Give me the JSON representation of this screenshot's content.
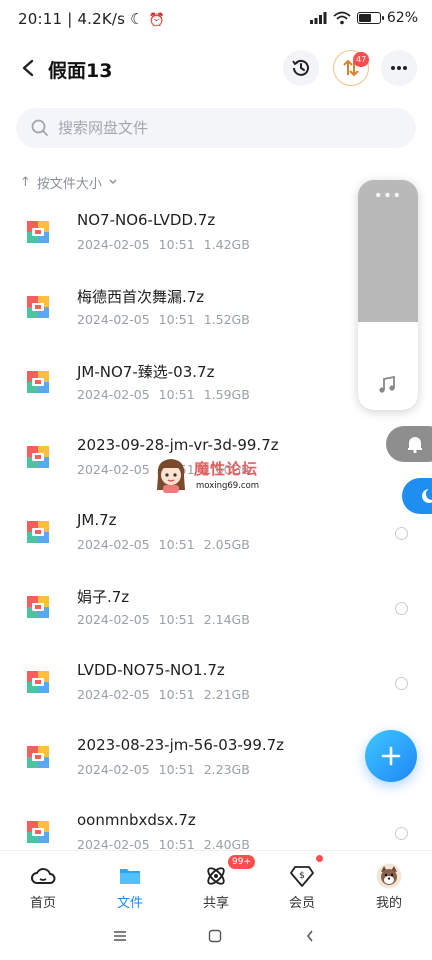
{
  "status_bar": {
    "time": "20:11",
    "speed": "4.2K/s",
    "battery": "62",
    "battery_level": 0.62
  },
  "header": {
    "title": "假面13",
    "transfer_badge": "47"
  },
  "search": {
    "placeholder": "搜索网盘文件"
  },
  "sort": {
    "label": "按文件大小"
  },
  "files": [
    {
      "name": "NO7-NO6-LVDD.7z",
      "date": "2024-02-05",
      "time": "10:51",
      "size": "1.42GB"
    },
    {
      "name": "梅德西首次舞漏.7z",
      "date": "2024-02-05",
      "time": "10:51",
      "size": "1.52GB"
    },
    {
      "name": "JM-NO7-臻选-03.7z",
      "date": "2024-02-05",
      "time": "10:51",
      "size": "1.59GB"
    },
    {
      "name": "2023-09-28-jm-vr-3d-99.7z",
      "date": "2024-02-05",
      "time": "10:51",
      "size": "1.60GB"
    },
    {
      "name": "JM.7z",
      "date": "2024-02-05",
      "time": "10:51",
      "size": "2.05GB"
    },
    {
      "name": "娟子.7z",
      "date": "2024-02-05",
      "time": "10:51",
      "size": "2.14GB"
    },
    {
      "name": "LVDD-NO75-NO1.7z",
      "date": "2024-02-05",
      "time": "10:51",
      "size": "2.21GB"
    },
    {
      "name": "2023-08-23-jm-56-03-99.7z",
      "date": "2024-02-05",
      "time": "10:51",
      "size": "2.23GB"
    },
    {
      "name": "oonmnbxdsx.7z",
      "date": "2024-02-05",
      "time": "10:51",
      "size": "2.40GB"
    }
  ],
  "watermark": {
    "title": "魔性论坛",
    "url": "moxing69.com"
  },
  "bottom_nav": [
    {
      "label": "首页",
      "icon": "cloud-home-icon"
    },
    {
      "label": "文件",
      "icon": "folder-icon"
    },
    {
      "label": "共享",
      "icon": "share-atom-icon",
      "badge": "99+"
    },
    {
      "label": "会员",
      "icon": "vip-diamond-icon"
    },
    {
      "label": "我的",
      "icon": "avatar"
    }
  ],
  "colors": {
    "accent": "#1e86f5",
    "badge": "#ff4d4f",
    "meta_text": "#9aa0aa"
  }
}
